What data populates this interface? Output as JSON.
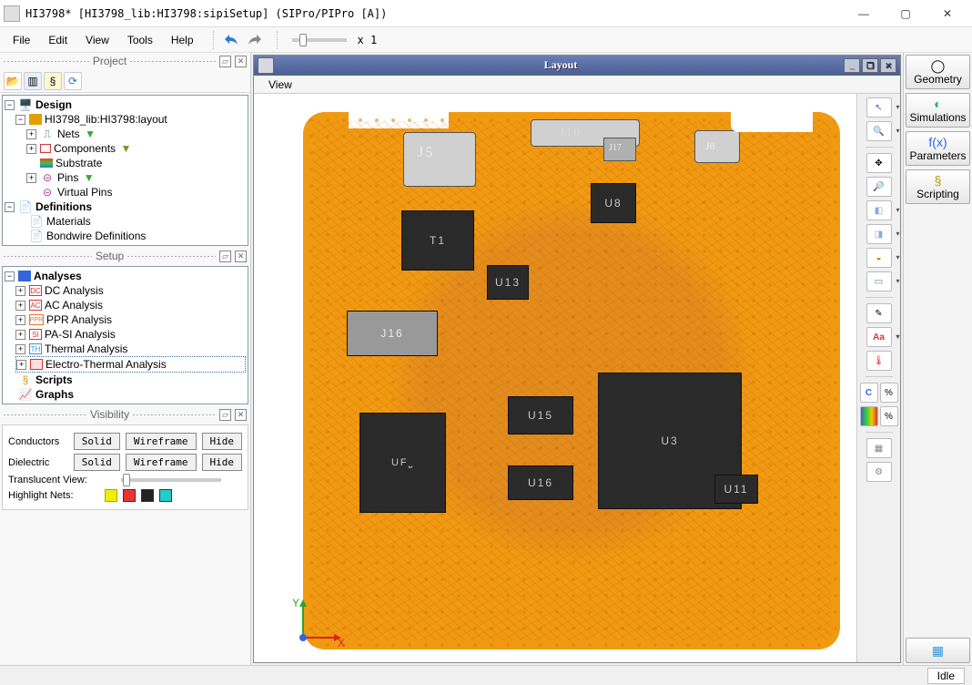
{
  "title": "HI3798* [HI3798_lib:HI3798:sipiSetup] (SIPro/PIPro [A])",
  "menu": {
    "file": "File",
    "edit": "Edit",
    "view": "View",
    "tools": "Tools",
    "help": "Help",
    "zoom_label": "x 1"
  },
  "project_panel": {
    "title": "Project",
    "tree": {
      "design": "Design",
      "layout": "HI3798_lib:HI3798:layout",
      "nets": "Nets",
      "components": "Components",
      "substrate": "Substrate",
      "pins": "Pins",
      "vpins": "Virtual Pins",
      "definitions": "Definitions",
      "materials": "Materials",
      "bondwire": "Bondwire Definitions"
    }
  },
  "setup_panel": {
    "title": "Setup",
    "analyses": "Analyses",
    "items": {
      "dc": "DC Analysis",
      "ac": "AC Analysis",
      "ppr": "PPR Analysis",
      "pasi": "PA-SI Analysis",
      "thermal": "Thermal Analysis",
      "eth": "Electro-Thermal Analysis"
    },
    "scripts": "Scripts",
    "graphs": "Graphs"
  },
  "visibility": {
    "title": "Visibility",
    "conductors": "Conductors",
    "dielectric": "Dielectric",
    "solid": "Solid",
    "wireframe": "Wireframe",
    "hide": "Hide",
    "translucent": "Translucent View:",
    "highlight": "Highlight Nets:"
  },
  "layout_win": {
    "title": "Layout",
    "view": "View"
  },
  "pcb_labels": {
    "J5": "J5",
    "J10": "J10",
    "J17": "J17",
    "J8": "J8",
    "T1": "T1",
    "U8": "U8",
    "U13": "U13",
    "J16": "J16",
    "U15": "U15",
    "U3": "U3",
    "U16": "U16",
    "U11": "U11"
  },
  "side_tabs": {
    "geometry": "Geometry",
    "simulations": "Simulations",
    "parameters": "Parameters",
    "scripting": "Scripting"
  },
  "status": {
    "idle": "Idle"
  }
}
